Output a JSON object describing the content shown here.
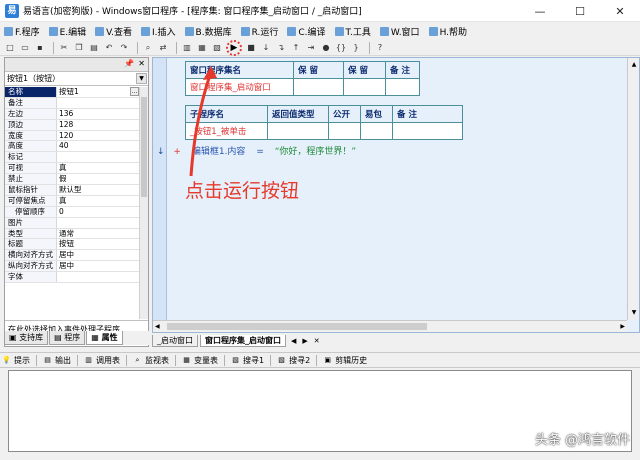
{
  "window": {
    "title": "易语言(加密狗版) - Windows窗口程序 - [程序集: 窗口程序集_启动窗口 / _启动窗口]",
    "minimize": "—",
    "maximize": "☐",
    "close": "✕"
  },
  "menu": [
    {
      "label": "F.程序",
      "icon": "program-icon"
    },
    {
      "label": "E.编辑",
      "icon": "edit-icon"
    },
    {
      "label": "V.查看",
      "icon": "view-icon"
    },
    {
      "label": "I.插入",
      "icon": "insert-icon"
    },
    {
      "label": "B.数据库",
      "icon": "database-icon"
    },
    {
      "label": "R.运行",
      "icon": "run-icon"
    },
    {
      "label": "C.编译",
      "icon": "compile-icon"
    },
    {
      "label": "T.工具",
      "icon": "tools-icon"
    },
    {
      "label": "W.窗口",
      "icon": "window-icon"
    },
    {
      "label": "H.帮助",
      "icon": "help-icon"
    }
  ],
  "toolbar": {
    "run_glyph": "▶"
  },
  "properties": {
    "selected_object": "按钮1（按钮）",
    "rows": [
      {
        "name": "名称",
        "value": "按钮1"
      },
      {
        "name": "备注",
        "value": ""
      },
      {
        "name": "左边",
        "value": "136"
      },
      {
        "name": "顶边",
        "value": "128"
      },
      {
        "name": "宽度",
        "value": "120"
      },
      {
        "name": "高度",
        "value": "40"
      },
      {
        "name": "标记",
        "value": ""
      },
      {
        "name": "可视",
        "value": "真"
      },
      {
        "name": "禁止",
        "value": "假"
      },
      {
        "name": "鼠标指针",
        "value": "默认型"
      },
      {
        "name": "可停留焦点",
        "value": "真"
      },
      {
        "name": "停留顺序",
        "value": "0"
      },
      {
        "name": "图片",
        "value": ""
      },
      {
        "name": "类型",
        "value": "通常"
      },
      {
        "name": "标题",
        "value": "按钮"
      },
      {
        "name": "横向对齐方式",
        "value": "居中"
      },
      {
        "name": "纵向对齐方式",
        "value": "居中"
      },
      {
        "name": "字体",
        "value": ""
      }
    ],
    "hint": "在此处选择加入事件处理子程序"
  },
  "left_tabs": [
    "支持库",
    "程序",
    "属性"
  ],
  "editor": {
    "assembly_table": {
      "headers": [
        "窗口程序集名",
        "保 留",
        "保 留",
        "备 注"
      ],
      "row": [
        "窗口程序集_启动窗口",
        "",
        "",
        ""
      ]
    },
    "sub_table": {
      "headers": [
        "子程序名",
        "返回值类型",
        "公开",
        "易包",
        "备 注"
      ],
      "row": [
        "_按钮1_被单击",
        "",
        "",
        "",
        ""
      ]
    },
    "code": {
      "arrow": "↓",
      "plus": "+",
      "object": "编辑框1.内容",
      "op": "=",
      "string": "“你好，程序世界！”"
    },
    "annotation": "点击运行按钮"
  },
  "editor_tabs": [
    "_启动窗口",
    "窗口程序集_启动窗口"
  ],
  "bottom_tabs": [
    {
      "label": "提示",
      "icon": "tip-icon"
    },
    {
      "label": "输出",
      "icon": "output-icon"
    },
    {
      "label": "调用表",
      "icon": "call-table-icon"
    },
    {
      "label": "监视表",
      "icon": "watch-icon"
    },
    {
      "label": "变量表",
      "icon": "variable-icon"
    },
    {
      "label": "搜寻1",
      "icon": "search1-icon"
    },
    {
      "label": "搜寻2",
      "icon": "search2-icon"
    },
    {
      "label": "剪辑历史",
      "icon": "clip-history-icon"
    }
  ],
  "watermark": "头条 @鸿言软件",
  "colors": {
    "annotation": "#e5392b",
    "editor_bg": "#e6f0fb",
    "selected_row": "#0a246a"
  }
}
